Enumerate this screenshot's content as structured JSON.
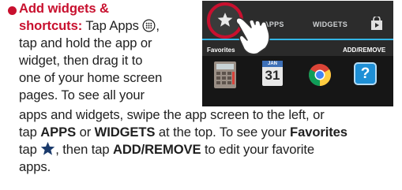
{
  "text": {
    "heading": "Add widgets &",
    "heading_cont": "shortcuts:",
    "tap_apps": " Tap Apps ",
    "line2": "tap and hold the app or",
    "line3": "widget, then drag it to",
    "line4": "one of your home screen",
    "line5": "pages. To see all your",
    "line6": "apps and widgets, swipe the app screen to the left, or",
    "tap": "tap ",
    "apps_bold": "APPS",
    "or": " or ",
    "widgets_bold": "WIDGETS",
    "at_top": " at the top. To see your ",
    "favorites_bold": "Favorites",
    "tap2": "tap ",
    "then_tap": ", then tap ",
    "add_remove_bold": "ADD/REMOVE",
    "to_edit": " to edit your favorite",
    "last": "apps."
  },
  "screenshot": {
    "tab_apps": "APPS",
    "tab_widgets": "WIDGETS",
    "favorites": "Favorites",
    "add_remove": "ADD/REMOVE",
    "calendar_month": "JAN",
    "calendar_day": "31"
  },
  "colors": {
    "accent_red": "#c8102e",
    "holo_blue": "#33b5e5"
  },
  "icons": [
    "apps-grid-icon",
    "star-icon",
    "store-bag-icon",
    "pointing-hand-icon",
    "calculator-icon",
    "calendar-icon",
    "chrome-icon",
    "help-icon"
  ]
}
